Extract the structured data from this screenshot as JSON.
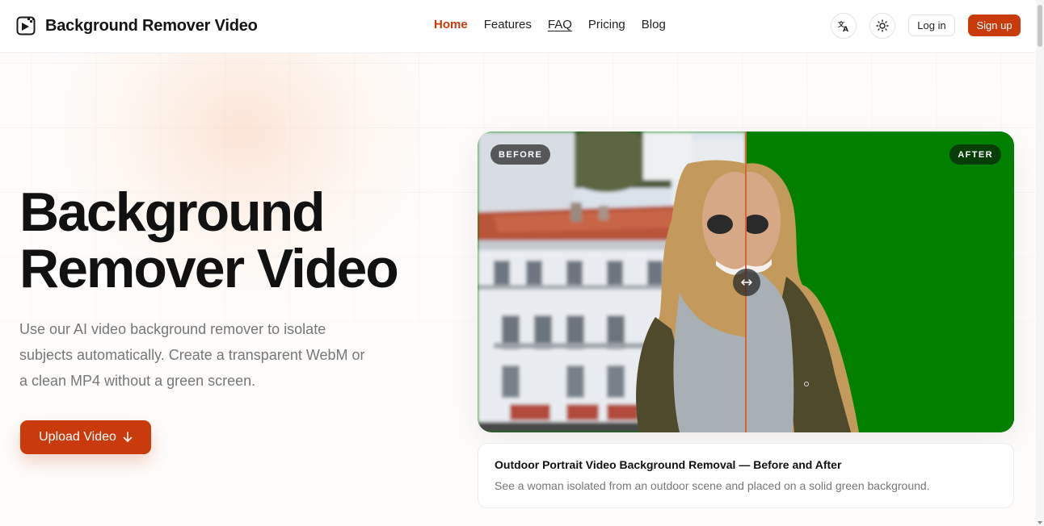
{
  "header": {
    "brand": "Background Remover Video",
    "nav": [
      {
        "label": "Home",
        "active": true
      },
      {
        "label": "Features"
      },
      {
        "label": "FAQ"
      },
      {
        "label": "Pricing"
      },
      {
        "label": "Blog"
      }
    ],
    "language_icon": "translate-icon",
    "theme_icon": "sun-icon",
    "login_label": "Log in",
    "signup_label": "Sign up"
  },
  "hero": {
    "title_line1": "Background",
    "title_line2": "Remover Video",
    "description": "Use our AI video background remover to isolate subjects automatically. Create a transparent WebM or a clean MP4 without a green screen.",
    "upload_label": "Upload Video",
    "upload_icon": "arrow-down-icon"
  },
  "comparison": {
    "before_label": "BEFORE",
    "after_label": "AFTER",
    "handle_icon": "double-arrow-icon",
    "after_background_color": "#008000"
  },
  "caption": {
    "title": "Outdoor Portrait Video Background Removal — Before and After",
    "description": "See a woman isolated from an outdoor scene and placed on a solid green background."
  },
  "colors": {
    "accent": "#c93a0c",
    "text": "#111111",
    "muted": "#777777"
  }
}
